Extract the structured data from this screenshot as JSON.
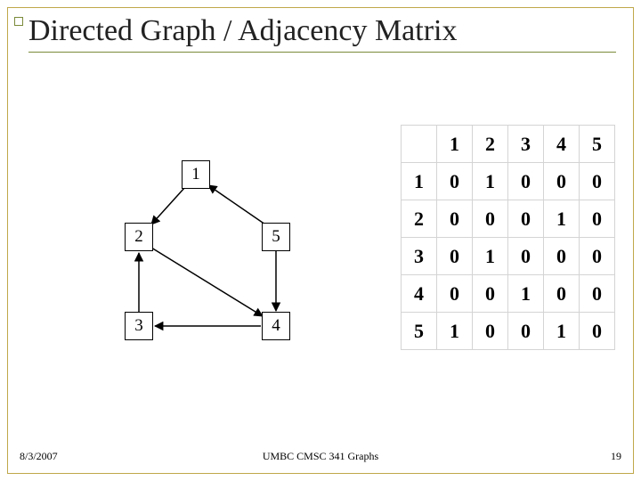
{
  "title": "Directed Graph / Adjacency Matrix",
  "nodes": {
    "n1": "1",
    "n2": "2",
    "n3": "3",
    "n4": "4",
    "n5": "5"
  },
  "matrix": {
    "col_headers": [
      "1",
      "2",
      "3",
      "4",
      "5"
    ],
    "row_headers": [
      "1",
      "2",
      "3",
      "4",
      "5"
    ],
    "rows": [
      [
        "0",
        "1",
        "0",
        "0",
        "0"
      ],
      [
        "0",
        "0",
        "0",
        "1",
        "0"
      ],
      [
        "0",
        "1",
        "0",
        "0",
        "0"
      ],
      [
        "0",
        "0",
        "1",
        "0",
        "0"
      ],
      [
        "1",
        "0",
        "0",
        "1",
        "0"
      ]
    ]
  },
  "edges": [
    {
      "from": 1,
      "to": 2
    },
    {
      "from": 2,
      "to": 4
    },
    {
      "from": 3,
      "to": 2
    },
    {
      "from": 4,
      "to": 3
    },
    {
      "from": 5,
      "to": 1
    },
    {
      "from": 5,
      "to": 4
    }
  ],
  "footer": {
    "date": "8/3/2007",
    "center": "UMBC CMSC 341 Graphs",
    "page": "19"
  }
}
